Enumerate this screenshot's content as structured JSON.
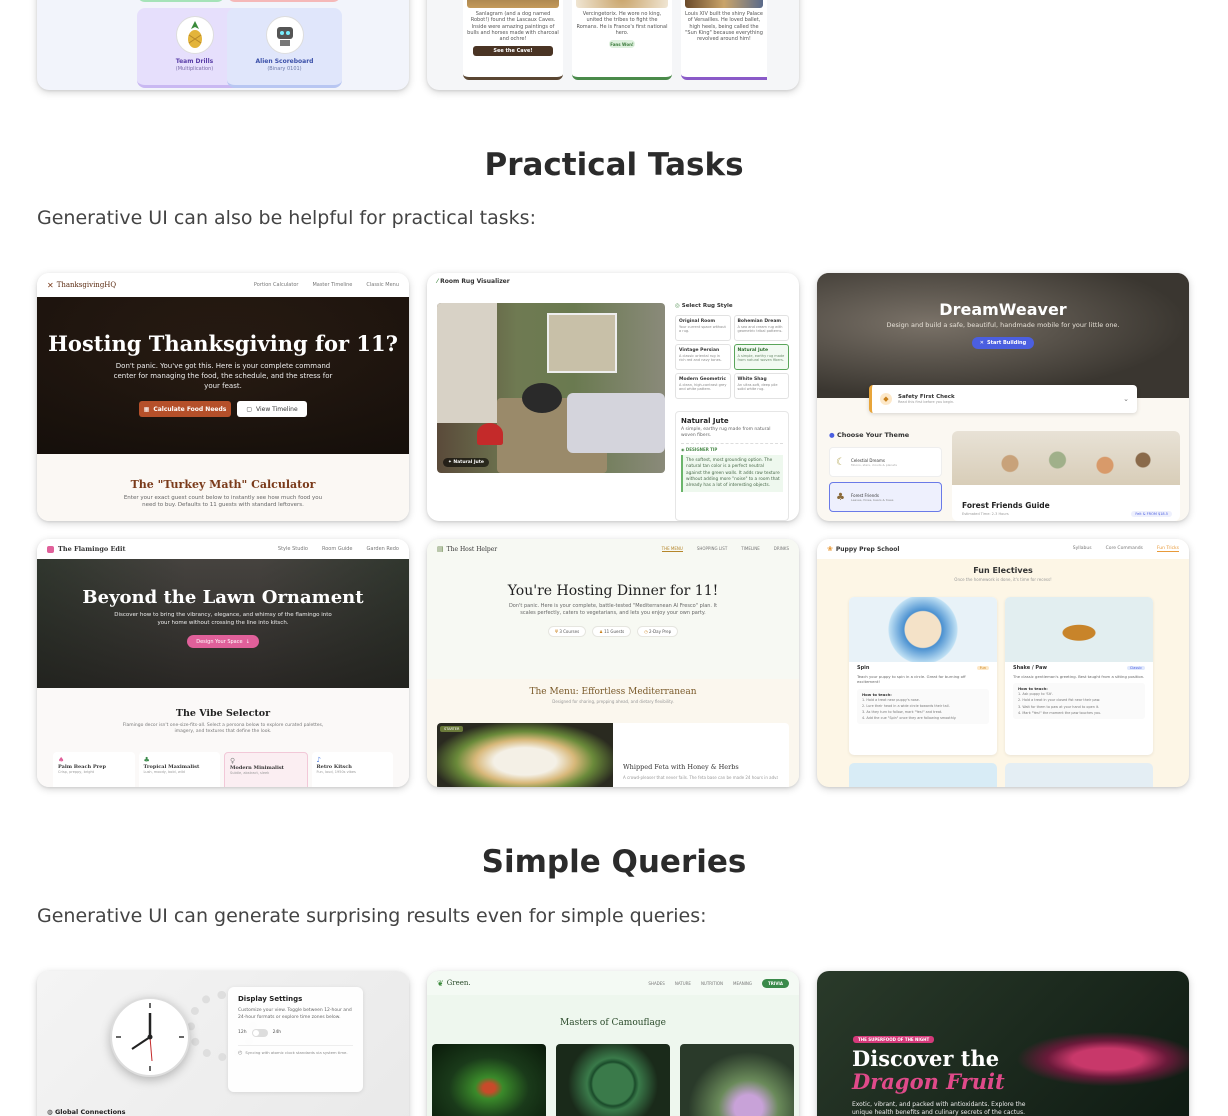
{
  "sections": {
    "practical": {
      "title": "Practical Tasks",
      "description": "Generative UI can also be helpful for practical tasks:"
    },
    "simple": {
      "title": "Simple Queries",
      "description": "Generative UI can generate surprising results even for simple queries:"
    }
  },
  "top_cards": {
    "math": {
      "items": [
        {
          "title": "Team Drills",
          "sub": "(Multiplication)"
        },
        {
          "title": "Alien Scoreboard",
          "sub": "(Binary 0101)"
        }
      ]
    },
    "history": {
      "col1_text": "Sanlagram (and a dog named Robot!) found the Lascaux Caves. Inside were amazing paintings of bulls and horses made with charcoal and ochre!",
      "col1_button": "See the Cave!",
      "col2_text": "Vercingetorix. He wore no king, united the tribes to fight the Romans. He is France's first national hero.",
      "col2_button": "Fans Won!",
      "col3_text": "Louis XIV built the shiny Palace of Versailles. He loved ballet, high heels, being called the \"Sun King\" because everything revolved around him!"
    }
  },
  "thanksgiving": {
    "brand": "ThanksgivingHQ",
    "nav": [
      "Portion Calculator",
      "Master Timeline",
      "Classic Menu"
    ],
    "hero_title": "Hosting Thanksgiving for 11?",
    "hero_text": "Don't panic. You've got this. Here is your complete command center for managing the food, the schedule, and the stress for your feast.",
    "btn_primary": "Calculate Food Needs",
    "btn_secondary": "View Timeline",
    "section_title": "The \"Turkey Math\" Calculator",
    "section_text": "Enter your exact guest count below to instantly see how much food you need to buy. Defaults to 11 guests with standard leftovers."
  },
  "rug": {
    "title": "Room Rug Visualizer",
    "select_label": "Select Rug Style",
    "options": [
      {
        "name": "Original Room",
        "desc": "Your current space without a rug."
      },
      {
        "name": "Bohemian Dream",
        "desc": "A sea and cream rug with geometric tribal patterns."
      },
      {
        "name": "Vintage Persian",
        "desc": "A classic oriental rug in rich red and navy tones."
      },
      {
        "name": "Natural Jute",
        "desc": "A simple, earthy rug made from natural woven fibers."
      },
      {
        "name": "Modern Geometric",
        "desc": "A clean, high-contrast grey and white pattern."
      },
      {
        "name": "White Shag",
        "desc": "An ultra-soft, deep pile solid white rug."
      }
    ],
    "photo_tag": "Natural Jute",
    "detail_title": "Natural Jute",
    "detail_text": "A simple, earthy rug made from natural woven fibers.",
    "tip_label": "DESIGNER TIP",
    "tip_text": "The softest, most grounding option. The natural tan color is a perfect neutral against the green walls. It adds raw texture without adding more \"noise\" to a room that already has a lot of interesting objects."
  },
  "dreamweaver": {
    "title": "DreamWeaver",
    "subtitle": "Design and build a safe, beautiful, handmade mobile for your little one.",
    "cta": "Start Building",
    "safety_title": "Safety First Check",
    "safety_sub": "Read this first before you begin.",
    "theme_label": "Choose Your Theme",
    "themes": [
      {
        "name": "Celestial Dreams",
        "desc": "Moons, stars, clouds & planets"
      },
      {
        "name": "Forest Friends",
        "desc": "Leaves, foxes, bears & trees"
      }
    ],
    "guide_title": "Forest Friends Guide",
    "guide_time": "Estimated Time: 2-3 Hours",
    "guide_badge": "Felt & FROM $18.5"
  },
  "flamingo": {
    "brand": "The Flamingo Edit",
    "nav": [
      "Style Studio",
      "Room Guide",
      "Garden Redo"
    ],
    "hero_title": "Beyond the Lawn Ornament",
    "hero_text": "Discover how to bring the vibrancy, elegance, and whimsy of the flamingo into your home without crossing the line into kitsch.",
    "cta": "Design Your Space",
    "section_title": "The Vibe Selector",
    "section_text": "Flamingo decor isn't one-size-fits-all. Select a persona below to explore curated palettes, imagery, and textures that define the look.",
    "personas": [
      {
        "name": "Palm Beach Prep",
        "desc": "Crisp, preppy, bright"
      },
      {
        "name": "Tropical Maximalist",
        "desc": "Lush, moody, bold, wild"
      },
      {
        "name": "Modern Minimalist",
        "desc": "Subtle, abstract, sleek"
      },
      {
        "name": "Retro Kitsch",
        "desc": "Fun, loud, 1950s vibes"
      }
    ]
  },
  "host": {
    "brand": "The Host Helper",
    "nav": [
      "THE MENU",
      "SHOPPING LIST",
      "TIMELINE",
      "DRINKS"
    ],
    "hero_title": "You're Hosting Dinner for 11!",
    "hero_text": "Don't panic. Here is your complete, battle-tested \"Mediterranean Al Fresco\" plan. It scales perfectly, caters to vegetarians, and lets you enjoy your own party.",
    "chips": [
      "3 Courses",
      "11 Guests",
      "2-Day Prep"
    ],
    "menu_title": "The Menu: Effortless Mediterranean",
    "menu_sub": "Designed for sharing, prepping ahead, and dietary flexibility.",
    "dish_tag": "STARTER",
    "dish_title": "Whipped Feta with Honey & Herbs",
    "dish_text": "A crowd-pleaser that never fails. The feta base can be made 24 hours in advance."
  },
  "puppy": {
    "brand": "Puppy Prep School",
    "nav": [
      "Syllabus",
      "Core Commands",
      "Fun Tricks"
    ],
    "title": "Fun Electives",
    "subtitle": "Once the homework is done, it's time for recess!",
    "tricks": [
      {
        "name": "Spin",
        "badge": "Fun",
        "desc": "Teach your puppy to spin in a circle. Great for burning off excitement!",
        "howto": "How to teach:",
        "steps": [
          "1. Hold a treat near puppy's nose.",
          "2. Lure their head in a wide circle towards their tail.",
          "3. As they turn to follow, mark \"Yes!\" and treat.",
          "4. Add the cue \"Spin\" once they are following smoothly."
        ]
      },
      {
        "name": "Shake / Paw",
        "badge": "Classic",
        "desc": "The classic gentleman's greeting. Best taught from a sitting position.",
        "howto": "How to teach:",
        "steps": [
          "1. Ask puppy to 'Sit'.",
          "2. Hold a treat in your closed fist near their paw.",
          "3. Wait for them to paw at your hand to open it.",
          "4. Mark \"Yes!\" the moment the paw touches you."
        ]
      }
    ]
  },
  "clock": {
    "panel_title": "Display Settings",
    "panel_text": "Customize your view. Toggle between 12-hour and 24-hour formats or explore time zones below.",
    "toggle_left": "12h",
    "toggle_right": "24h",
    "sync_text": "Syncing with atomic clock standards via system time.",
    "footer": "Global Connections"
  },
  "green": {
    "brand": "Green.",
    "nav": [
      "SHADES",
      "NATURE",
      "NUTRITION",
      "MEANING"
    ],
    "nav_cta": "TRIVIA",
    "title": "Masters of Camouflage"
  },
  "dragon": {
    "tag": "THE SUPERFOOD OF THE NIGHT",
    "title_line1": "Discover the",
    "title_line2": "Dragon Fruit",
    "text": "Exotic, vibrant, and packed with antioxidants. Explore the unique health benefits and culinary secrets of the cactus."
  }
}
